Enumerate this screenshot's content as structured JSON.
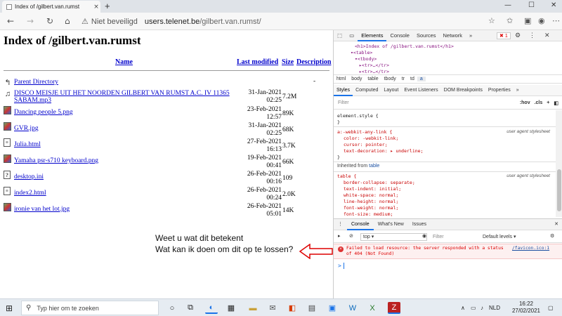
{
  "browser": {
    "tab_title": "Index of /gilbert.van.rumst",
    "tab_close": "×",
    "new_tab": "+",
    "window_controls": [
      "—",
      "☐",
      "✕"
    ],
    "security_label": "Niet beveiligd",
    "url_host": "users.telenet.be",
    "url_path": "/gilbert.van.rumst/"
  },
  "page": {
    "heading": "Index of /gilbert.van.rumst",
    "columns": {
      "name": "Name",
      "modified": "Last modified",
      "size": "Size",
      "description": "Description"
    },
    "parent": {
      "name": "Parent Directory",
      "desc": "-"
    },
    "files": [
      {
        "icon": "music",
        "name": "DISCO MEISJE UIT HET NOORDEN GILBERT VAN RUMST A.C. IV 11365 SABAM.mp3",
        "date": "31-Jan-2021 02:25",
        "size": "7.2M"
      },
      {
        "icon": "image",
        "name": "Dancing people 5.png",
        "date": "23-Feb-2021 12:57",
        "size": "89K"
      },
      {
        "icon": "image",
        "name": "GVR.jpg",
        "date": "31-Jan-2021 02:25",
        "size": "68K"
      },
      {
        "icon": "text",
        "name": "Julia.html",
        "date": "27-Feb-2021 16:13",
        "size": "3.7K"
      },
      {
        "icon": "image",
        "name": "Yamaha psr-s710 keyboard.png",
        "date": "19-Feb-2021 00:41",
        "size": "66K"
      },
      {
        "icon": "unknown",
        "name": "desktop.ini",
        "date": "26-Feb-2021 00:16",
        "size": "109"
      },
      {
        "icon": "text",
        "name": "index2.html",
        "date": "26-Feb-2021 00:24",
        "size": "2.0K"
      },
      {
        "icon": "image",
        "name": "ironie van het lot.jpg",
        "date": "26-Feb-2021 05:01",
        "size": "14K"
      }
    ],
    "note_line1": "Weet u wat dit betekent",
    "note_line2": "Wat kan ik doen om dit op te lossen?"
  },
  "devtools": {
    "tabs": [
      "Elements",
      "Console",
      "Sources",
      "Network",
      "»"
    ],
    "error_count": "1",
    "tree": [
      "<h1>Index of /gilbert.van.rumst</h1>",
      "▾<table>",
      "▾<tbody>",
      "▸<tr>…</tr>",
      "▸<tr>…</tr>"
    ],
    "breadcrumbs": [
      "html",
      "body",
      "table",
      "tbody",
      "tr",
      "td",
      "a"
    ],
    "subtabs": [
      "Styles",
      "Computed",
      "Layout",
      "Event Listeners",
      "DOM Breakpoints",
      "Properties",
      "»"
    ],
    "filter_placeholder": "Filter",
    "filter_hov": ":hov",
    "filter_cls": ".cls",
    "element_style": "element.style {",
    "close_brace": "}",
    "rule1_selector": "a:-webkit-any-link {",
    "rule1_props": [
      "color: -webkit-link;",
      "cursor: pointer;",
      "text-decoration: ▸ underline;"
    ],
    "ua_label": "user agent stylesheet",
    "inherited_prefix": "Inherited from",
    "inherited_from": "table",
    "rule2_selector": "table {",
    "rule2_props": [
      "border-collapse: separate;",
      "text-indent: initial;",
      "white-space: normal;",
      "line-height: normal;",
      "font-weight: normal;",
      "font-size: medium;"
    ],
    "drawer_tabs": [
      "Console",
      "What's New",
      "Issues"
    ],
    "context": "top",
    "console_filter": "Filter",
    "levels": "Default levels ▾",
    "error_message": "Failed to load resource: the server responded with a status of 404 (Not Found)",
    "error_link": "/favicon.ico:1",
    "prompt": ">"
  },
  "taskbar": {
    "search_placeholder": "Typ hier om te zoeken",
    "lang": "NLD",
    "time": "16:22",
    "date": "27/02/2021"
  },
  "colors": {
    "link": "#0000cc",
    "error": "#dd0000",
    "accent": "#1a73e8",
    "arrow": "#dd0000"
  }
}
